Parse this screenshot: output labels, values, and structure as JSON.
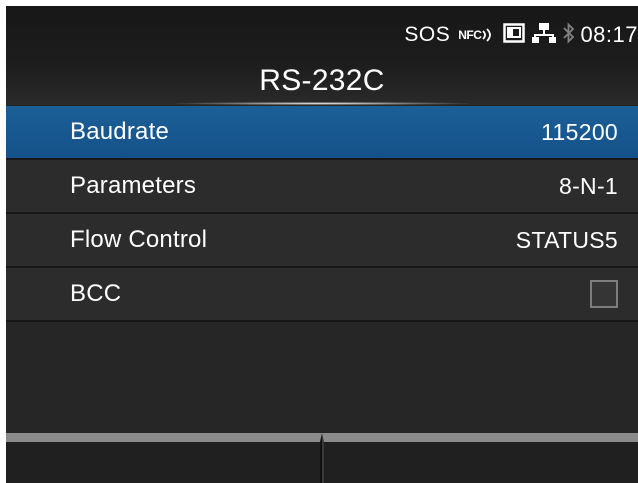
{
  "status_bar": {
    "sos": "SOS",
    "nfc": "NFC",
    "time": "08:17",
    "icons": [
      "nfc-icon",
      "sd-card-icon",
      "network-icon",
      "bluetooth-icon"
    ]
  },
  "header": {
    "title": "RS-232C"
  },
  "settings": [
    {
      "label": "Baudrate",
      "value": "115200",
      "selected": true
    },
    {
      "label": "Parameters",
      "value": "8-N-1",
      "selected": false
    },
    {
      "label": "Flow Control",
      "value": "STATUS5",
      "selected": false
    },
    {
      "label": "BCC",
      "value_type": "checkbox",
      "checked": false,
      "selected": false
    }
  ],
  "softkeys": {
    "left": "",
    "right": ""
  },
  "colors": {
    "background": "#262626",
    "selected_row": "#1c5f97",
    "text": "#ffffff",
    "softkey_bar": "#8b8b8b"
  }
}
